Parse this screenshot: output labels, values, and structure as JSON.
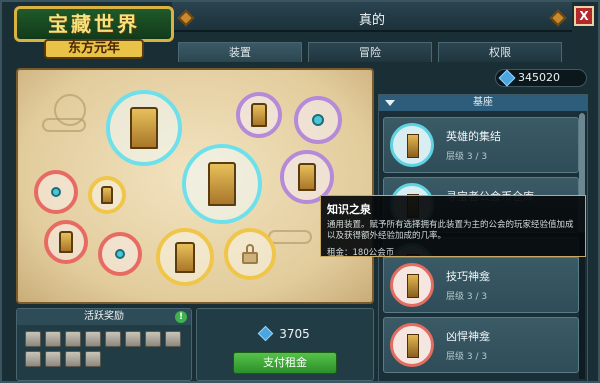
{
  "window": {
    "title": "真的",
    "close_label": "X"
  },
  "logo": {
    "line1": "宝藏世界",
    "line2": "东方元年"
  },
  "tabs": [
    {
      "label": "装置"
    },
    {
      "label": "冒险"
    },
    {
      "label": "权限"
    }
  ],
  "currency": {
    "amount": "345020",
    "icon": "gem-icon"
  },
  "list": {
    "header": "基座",
    "items": [
      {
        "name": "英雄的集结",
        "level": "层级 3 / 3",
        "ring": "cyan"
      },
      {
        "name": "寻宝者公会币仓库",
        "level": "",
        "ring": "cyan"
      },
      {
        "name": "",
        "level": "",
        "ring": "cyan"
      },
      {
        "name": "技巧神龛",
        "level": "层级 3 / 3",
        "ring": "red"
      },
      {
        "name": "凶悍神龛",
        "level": "层级 3 / 3",
        "ring": "red"
      }
    ]
  },
  "tooltip": {
    "title": "知识之泉",
    "description": "通用装置。赋予所有选择拥有此装置为主的公会的玩家经验值加成以及获得额外经验加成的几率。",
    "rent_label": "租金：",
    "rent_value": "180公会币"
  },
  "activity": {
    "title": "活跃奖励",
    "info": "!"
  },
  "rent": {
    "amount": "3705",
    "pay_label": "支付租金"
  },
  "colors": {
    "cyan": "#6ee0ec",
    "purple": "#b58ad8",
    "red": "#e76a63",
    "yellow": "#f0c64a",
    "pay": "#3fa838"
  }
}
